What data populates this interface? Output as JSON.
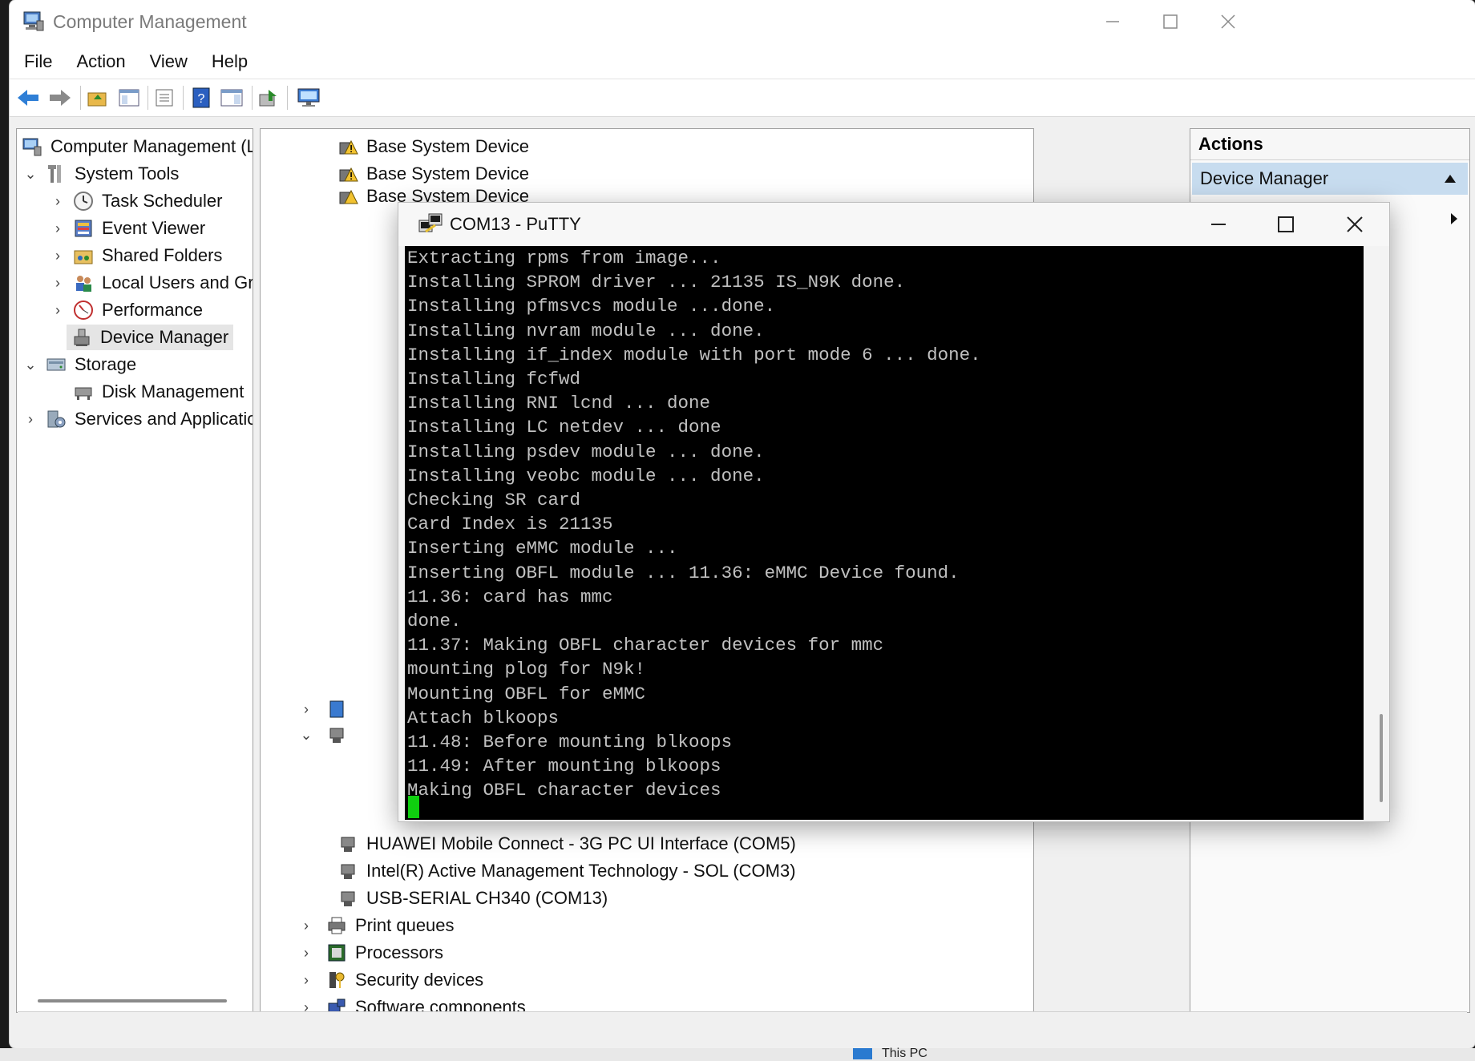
{
  "window": {
    "title": "Computer Management",
    "menu": [
      "File",
      "Action",
      "View",
      "Help"
    ]
  },
  "tree": {
    "root": "Computer Management (Local",
    "system_tools": "System Tools",
    "task_scheduler": "Task Scheduler",
    "event_viewer": "Event Viewer",
    "shared_folders": "Shared Folders",
    "local_users": "Local Users and Groups",
    "performance": "Performance",
    "device_manager": "Device Manager",
    "storage": "Storage",
    "disk_management": "Disk Management",
    "services": "Services and Applications"
  },
  "devices": {
    "base1": "Base System Device",
    "base2": "Base System Device",
    "base3": "Base System Device",
    "huawei": "HUAWEI Mobile Connect - 3G PC UI Interface (COM5)",
    "intel": "Intel(R) Active Management Technology - SOL (COM3)",
    "usb": "USB-SERIAL CH340 (COM13)",
    "print": "Print queues",
    "processors": "Processors",
    "security": "Security devices",
    "software": "Software components"
  },
  "actions": {
    "header": "Actions",
    "section": "Device Manager"
  },
  "putty": {
    "title": "COM13 - PuTTY",
    "lines": [
      "Extracting rpms from image...",
      "Installing SPROM driver ... 21135 IS_N9K done.",
      "Installing pfmsvcs module ...done.",
      "Installing nvram module ... done.",
      "Installing if_index module with port mode 6 ... done.",
      "Installing fcfwd",
      "Installing RNI lcnd ... done",
      "Installing LC netdev ... done",
      "Installing psdev module ... done.",
      "Installing veobc module ... done.",
      "Checking SR card",
      "Card Index is 21135",
      "Inserting eMMC module ...",
      "Inserting OBFL module ... 11.36: eMMC Device found.",
      "11.36: card has mmc",
      "done.",
      "11.37: Making OBFL character devices for mmc",
      "mounting plog for N9k!",
      "Mounting OBFL for eMMC",
      "Attach blkoops",
      "11.48: Before mounting blkoops",
      "11.49: After mounting blkoops",
      "Making OBFL character devices"
    ]
  },
  "taskbar": {
    "item": "This PC"
  }
}
